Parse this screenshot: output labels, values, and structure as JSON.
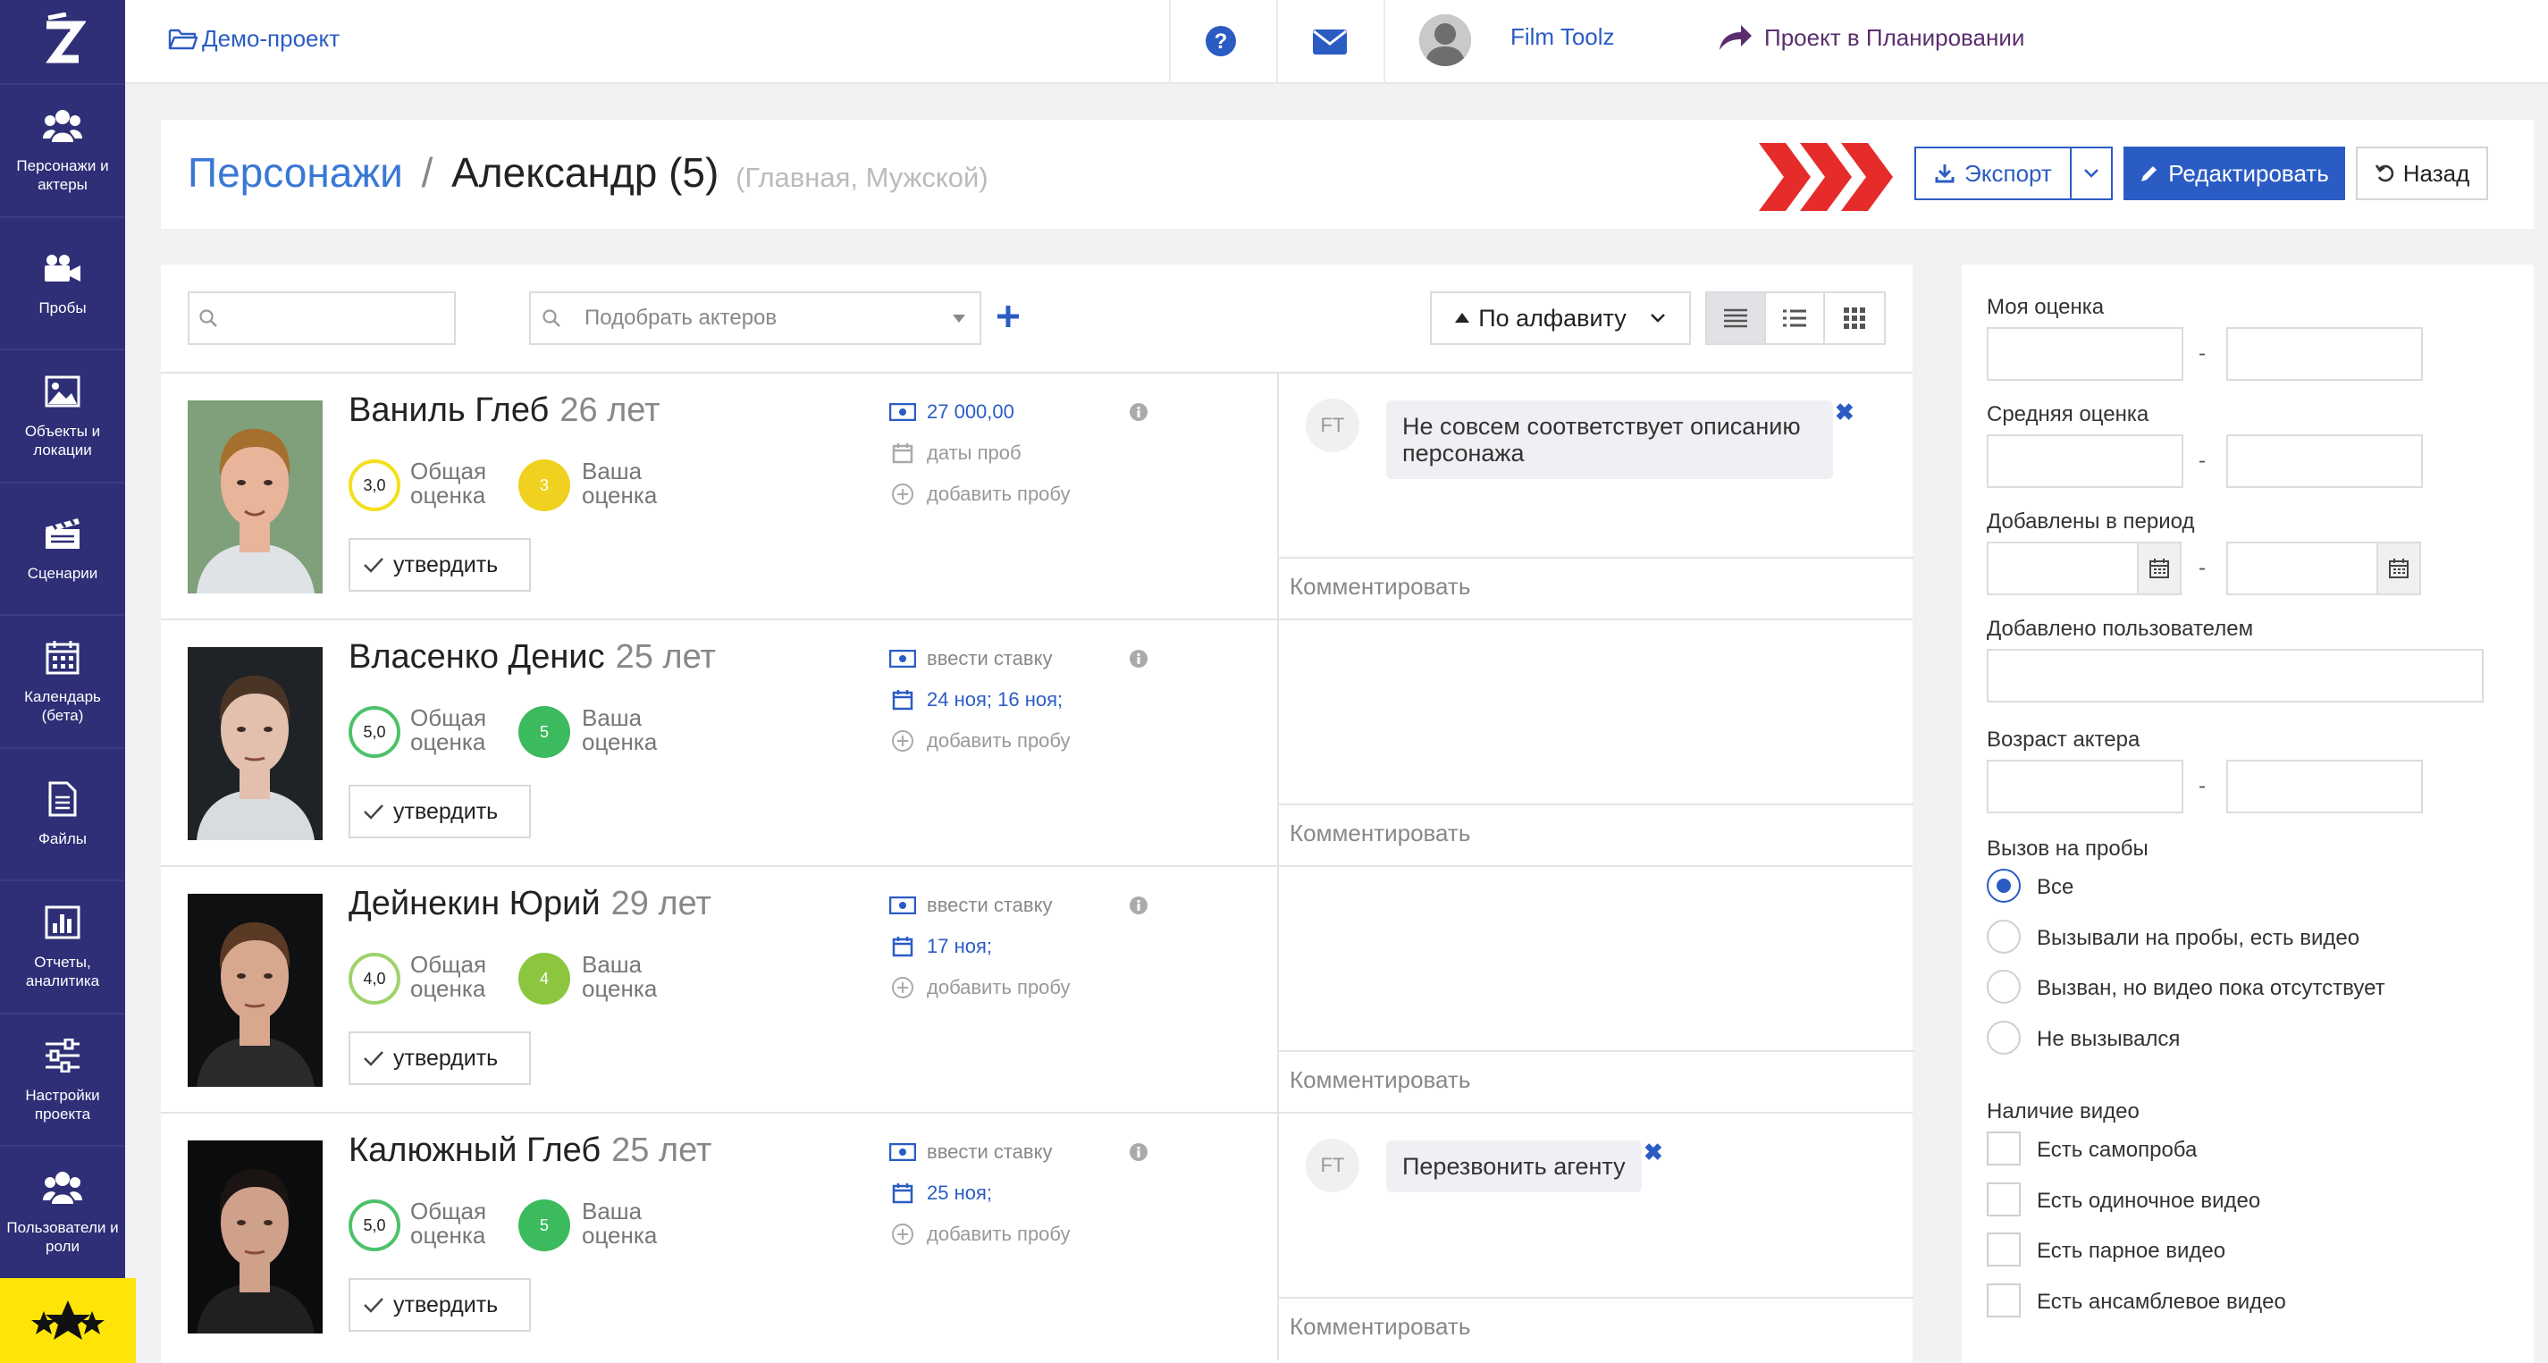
{
  "sidebar": {
    "items": [
      {
        "label": "Персонажи и актеры",
        "icon": "users-icon"
      },
      {
        "label": "Пробы",
        "icon": "video-camera-icon"
      },
      {
        "label": "Объекты и локации",
        "icon": "image-icon"
      },
      {
        "label": "Сценарии",
        "icon": "clapperboard-icon"
      },
      {
        "label": "Календарь (бета)",
        "icon": "calendar-icon"
      },
      {
        "label": "Файлы",
        "icon": "file-icon"
      },
      {
        "label": "Отчеты, аналитика",
        "icon": "bar-chart-icon"
      },
      {
        "label": "Настройки проекта",
        "icon": "sliders-icon"
      },
      {
        "label": "Пользователи и роли",
        "icon": "users-icon"
      }
    ]
  },
  "topbar": {
    "project": "Демо-проект",
    "status": "Проект в Планировании",
    "user": "Film Toolz"
  },
  "header": {
    "breadcrumb_root": "Персонажи",
    "separator": "/",
    "title": "Александр (5)",
    "subtitle": "(Главная, Мужской)",
    "export_label": "Экспорт",
    "edit_label": "Редактировать",
    "back_label": "Назад"
  },
  "toolbar": {
    "search_placeholder": "",
    "actor_picker_placeholder": "Подобрать актеров",
    "sort_label": "По алфавиту"
  },
  "actors": [
    {
      "name": "Ваниль Глеб",
      "age": "26 лет",
      "overall": "3,0",
      "yours": "3",
      "overall_color": "#f3df1c",
      "yours_color": "#f0d11f",
      "rate": "27 000,00",
      "rate_set": true,
      "dates": "даты проб",
      "dates_set": false,
      "add_audition": "добавить пробу",
      "approve": "утвердить",
      "comment_author": "FT",
      "comment": "Не совсем соответствует описанию персонажа",
      "comment_placeholder": "Комментировать"
    },
    {
      "name": "Власенко Денис",
      "age": "25 лет",
      "overall": "5,0",
      "yours": "5",
      "overall_color": "#4cc26a",
      "yours_color": "#3cba5e",
      "rate": "ввести ставку",
      "rate_set": false,
      "dates": "24 ноя; 16 ноя;",
      "dates_set": true,
      "add_audition": "добавить пробу",
      "approve": "утвердить",
      "comment_author": "",
      "comment": "",
      "comment_placeholder": "Комментировать"
    },
    {
      "name": "Дейнекин Юрий",
      "age": "29 лет",
      "overall": "4,0",
      "yours": "4",
      "overall_color": "#9ed36a",
      "yours_color": "#8cc63f",
      "rate": "ввести ставку",
      "rate_set": false,
      "dates": "17 ноя;",
      "dates_set": true,
      "add_audition": "добавить пробу",
      "approve": "утвердить",
      "comment_author": "",
      "comment": "",
      "comment_placeholder": "Комментировать"
    },
    {
      "name": "Калюжный Глеб",
      "age": "25 лет",
      "overall": "5,0",
      "yours": "5",
      "overall_color": "#4cc26a",
      "yours_color": "#3cba5e",
      "rate": "ввести ставку",
      "rate_set": false,
      "dates": "25 ноя;",
      "dates_set": true,
      "add_audition": "добавить пробу",
      "approve": "утвердить",
      "comment_author": "FT",
      "comment": "Перезвонить агенту",
      "comment_placeholder": "Комментировать"
    }
  ],
  "rating_labels": {
    "overall": "Общая оценка",
    "yours": "Ваша оценка"
  },
  "filters": {
    "my_rating": "Моя оценка",
    "avg_rating": "Средняя оценка",
    "added_period": "Добавлены в период",
    "added_by": "Добавлено пользователем",
    "actor_age": "Возраст актера",
    "audition_call": "Вызов на пробы",
    "radio_options": [
      "Все",
      "Вызывали на пробы, есть видео",
      "Вызван, но видео пока отсутствует",
      "Не вызывался"
    ],
    "radio_selected": 0,
    "video_presence": "Наличие видео",
    "checkbox_options": [
      "Есть самопроба",
      "Есть одиночное видео",
      "Есть парное видео",
      "Есть ансамблевое видео"
    ],
    "dash": "-"
  },
  "colors": {
    "sidebar": "#2e2f76",
    "primary": "#2b5cc4",
    "link": "#3a78d6",
    "accent_red": "#e62b2b",
    "status_purple": "#5a2e6e",
    "star_box": "#ffe40a"
  }
}
